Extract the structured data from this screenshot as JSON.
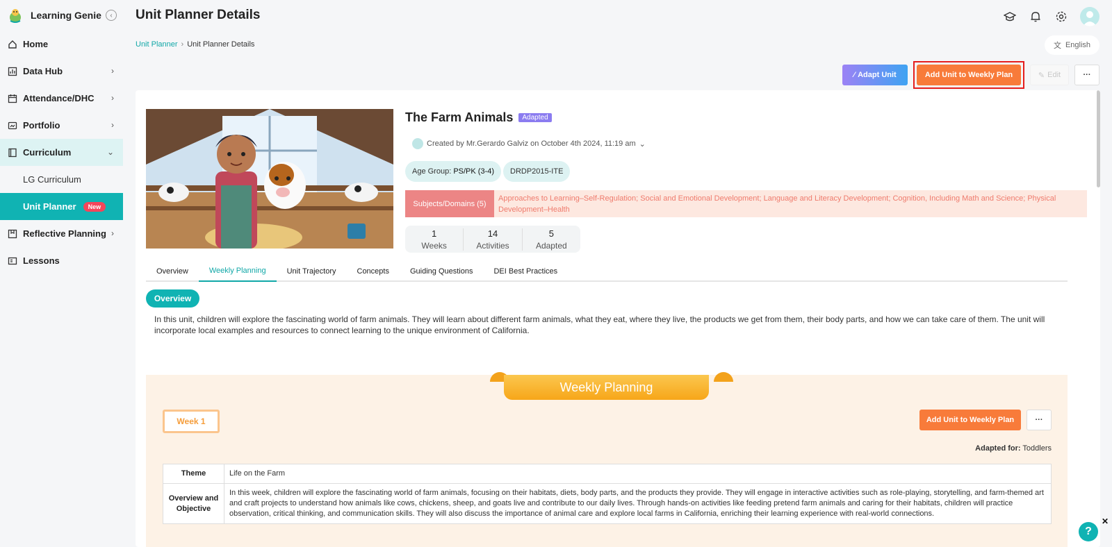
{
  "app": {
    "name": "Learning Genie"
  },
  "sidebar": {
    "items": [
      {
        "label": "Home",
        "icon": "home-icon"
      },
      {
        "label": "Data Hub",
        "icon": "chart-icon"
      },
      {
        "label": "Attendance/DHC",
        "icon": "calendar-icon"
      },
      {
        "label": "Portfolio",
        "icon": "portfolio-icon"
      },
      {
        "label": "Curriculum",
        "icon": "book-icon"
      },
      {
        "label": "LG Curriculum"
      },
      {
        "label": "Unit Planner",
        "badge": "New"
      },
      {
        "label": "Reflective Planning",
        "icon": "reflect-icon"
      },
      {
        "label": "Lessons",
        "icon": "lessons-icon"
      }
    ]
  },
  "header": {
    "title": "Unit Planner Details",
    "breadcrumb": [
      "Unit Planner",
      "Unit Planner Details"
    ],
    "language": "English"
  },
  "actions": {
    "adapt": "Adapt Unit",
    "add_weekly": "Add Unit to Weekly Plan",
    "edit": "Edit",
    "more": "···"
  },
  "unit": {
    "title": "The Farm Animals",
    "status": "Adapted",
    "creator": "Created by Mr.Gerardo Galviz on October 4th 2024, 11:19 am",
    "age_group_label": "Age Group:",
    "age_group_value": "PS/PK (3-4)",
    "framework": "DRDP2015-ITE",
    "subjects_label": "Subjects/Domains (5)",
    "subjects_text": "Approaches to Learning–Self-Regulation; Social and Emotional Development; Language and Literacy Development; Cognition, Including Math and Science; Physical Development–Health",
    "stats": [
      {
        "num": "1",
        "label": "Weeks"
      },
      {
        "num": "14",
        "label": "Activities"
      },
      {
        "num": "5",
        "label": "Adapted"
      }
    ]
  },
  "tabs": [
    "Overview",
    "Weekly Planning",
    "Unit Trajectory",
    "Concepts",
    "Guiding Questions",
    "DEI Best Practices"
  ],
  "overview": {
    "label": "Overview",
    "text": "In this unit, children will explore the fascinating world of farm animals. They will learn about different farm animals, what they eat, where they live, the products we get from them, their body parts, and how we can take care of them. The unit will incorporate local examples and resources to connect learning to the unique environment of California."
  },
  "weekly": {
    "ribbon": "Weekly Planning",
    "week_label": "Week 1",
    "add_btn": "Add Unit to Weekly Plan",
    "more": "···",
    "adapted_for_label": "Adapted for:",
    "adapted_for_value": "Toddlers",
    "rows": [
      {
        "head": "Theme",
        "value": "Life on the Farm"
      },
      {
        "head": "Overview and Objective",
        "value": "In this week, children will explore the fascinating world of farm animals, focusing on their habitats, diets, body parts, and the products they provide. They will engage in interactive activities such as role-playing, storytelling, and farm-themed art and craft projects to understand how animals like cows, chickens, sheep, and goats live and contribute to our daily lives. Through hands-on activities like feeding pretend farm animals and caring for their habitats, children will practice observation, critical thinking, and communication skills. They will also discuss the importance of animal care and explore local farms in California, enriching their learning experience with real-world connections."
      }
    ]
  },
  "help": {
    "label": "?",
    "close": "✕"
  },
  "colors": {
    "teal": "#10b3b3",
    "orange": "#f87b3a",
    "highlight": "#e51d1d"
  }
}
